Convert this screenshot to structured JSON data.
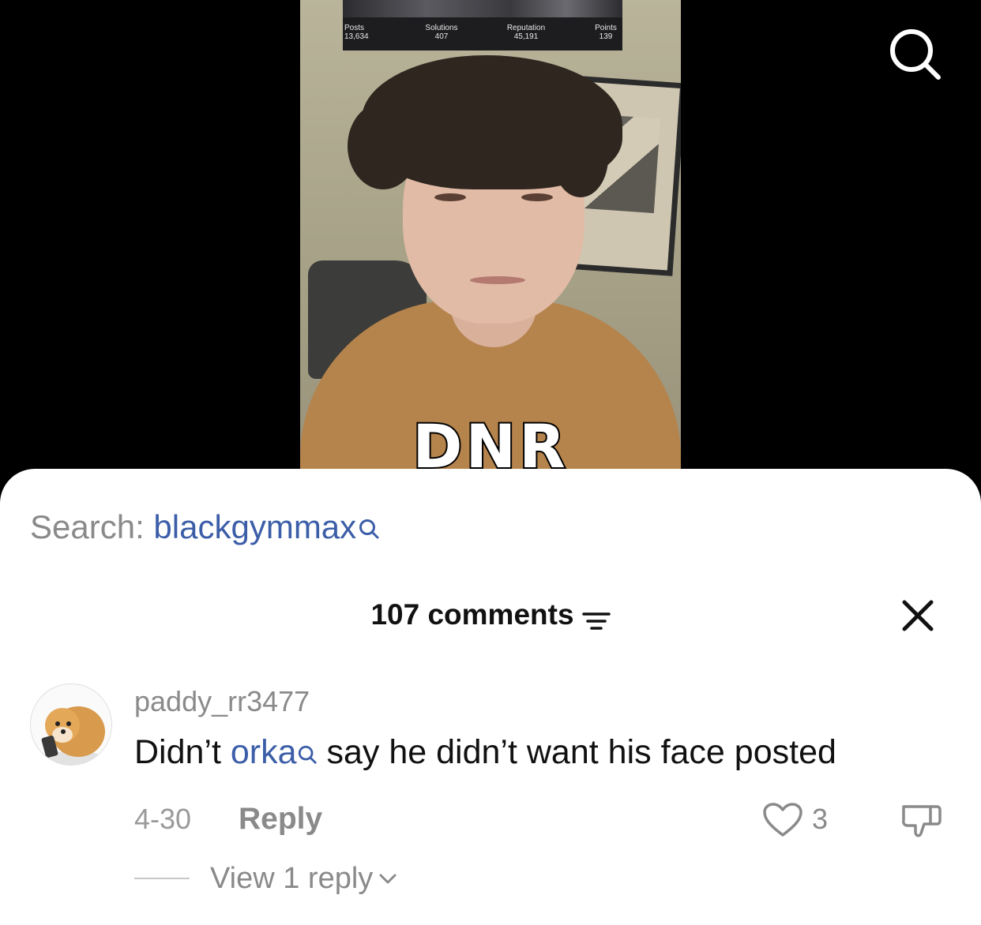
{
  "video": {
    "stats": [
      {
        "label": "Posts",
        "value": "13,634"
      },
      {
        "label": "Solutions",
        "value": "407"
      },
      {
        "label": "Reputation",
        "value": "45,191"
      },
      {
        "label": "Points",
        "value": "139"
      }
    ],
    "overlay_caption": "DNR"
  },
  "search": {
    "prefix": "Search:",
    "query": "blackgymmax"
  },
  "comments_header": {
    "count_label": "107 comments"
  },
  "comment": {
    "username": "paddy_rr3477",
    "text_before": "Didn’t ",
    "mention": "orka",
    "text_after": " say he didn’t want his face posted",
    "date": "4-30",
    "reply_label": "Reply",
    "like_count": "3",
    "view_replies_label": "View 1 reply"
  },
  "colors": {
    "link_blue": "#3c5ea8",
    "muted_gray": "#8a8a8a"
  }
}
